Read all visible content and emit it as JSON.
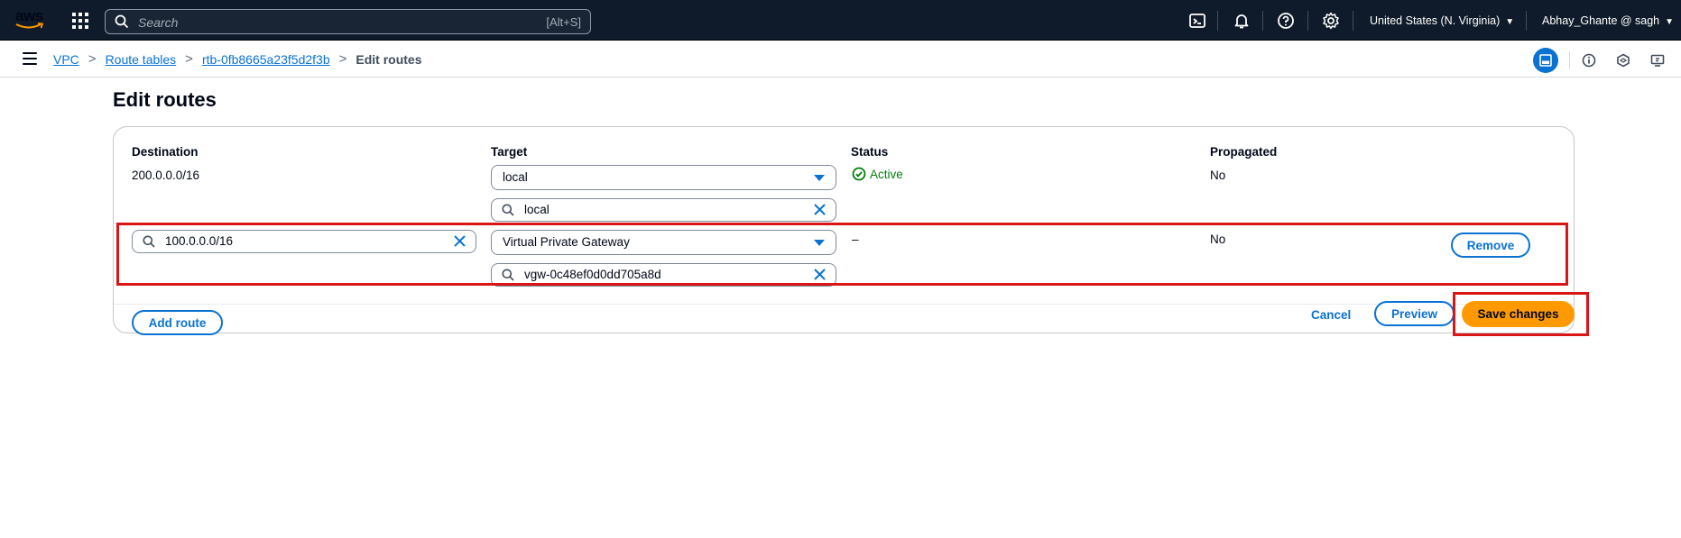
{
  "topnav": {
    "logo": "aws",
    "search_placeholder": "Search",
    "search_shortcut": "[Alt+S]",
    "region": "United States (N. Virginia)",
    "user": "Abhay_Ghante @ sagh",
    "icons": [
      "services-grid-icon",
      "search-icon",
      "cloudshell-icon",
      "notifications-icon",
      "help-icon",
      "settings-icon"
    ]
  },
  "breadcrumb": {
    "items": [
      "VPC",
      "Route tables",
      "rtb-0fb8665a23f5d2f3b"
    ],
    "current": "Edit routes"
  },
  "page": {
    "title": "Edit routes"
  },
  "routes": {
    "headers": {
      "destination": "Destination",
      "target": "Target",
      "status": "Status",
      "propagated": "Propagated"
    },
    "rows": [
      {
        "destination": "200.0.0.0/16",
        "target": "local",
        "target_filter": "local",
        "status": "Active",
        "propagated": "No"
      },
      {
        "destination": "100.0.0.0/16",
        "target": "Virtual Private Gateway",
        "target_filter": "vgw-0c48ef0d0dd705a8d",
        "status": "–",
        "propagated": "No",
        "remove_label": "Remove"
      }
    ],
    "add_route_label": "Add route"
  },
  "actions": {
    "cancel": "Cancel",
    "preview": "Preview",
    "save": "Save changes"
  },
  "colors": {
    "nav_bg": "#0f1b2a",
    "link": "#0972d3",
    "primary": "#ff9900",
    "success": "#037f0c",
    "highlight": "#d91515"
  }
}
